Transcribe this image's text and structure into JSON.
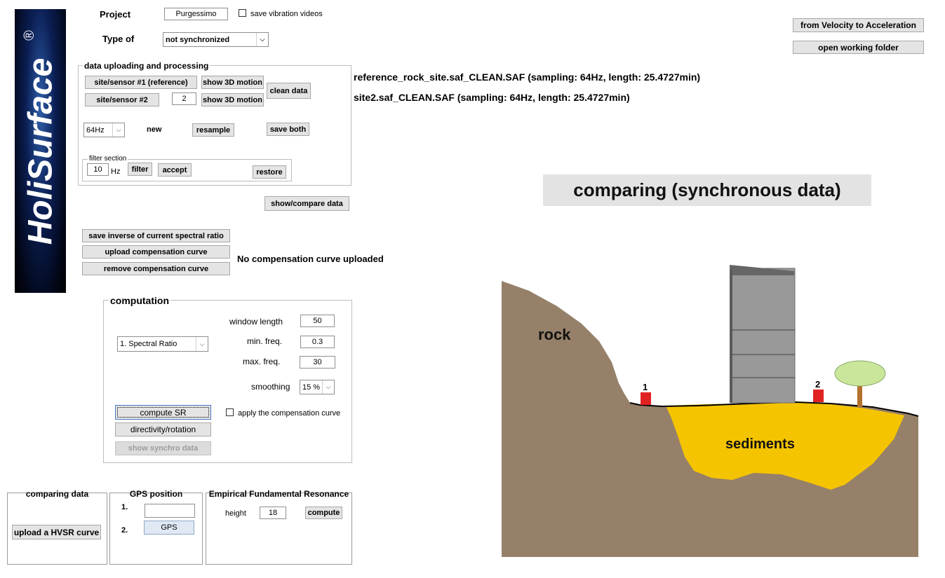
{
  "logo": {
    "text": "HoliSurface",
    "mark": "®"
  },
  "project": {
    "label": "Project",
    "value": "Purgessimo",
    "save_videos_label": "save vibration videos"
  },
  "type_of": {
    "label": "Type of",
    "selected": "not synchronized"
  },
  "top_right": {
    "velocity_button": "from Velocity to Acceleration",
    "folder_button": "open working folder"
  },
  "files": {
    "file1": "reference_rock_site.saf_CLEAN.SAF (sampling: 64Hz, length: 25.4727min)",
    "file2": "site2.saf_CLEAN.SAF (sampling: 64Hz, length: 25.4727min)"
  },
  "upload_group": {
    "title": "data uploading and processing",
    "sensor1_button": "site/sensor #1 (reference)",
    "sensor2_button": "site/sensor #2",
    "show3d_1": "show 3D motion",
    "show3d_2": "show 3D motion",
    "sensor_number": "2",
    "clean_button": "clean data",
    "sampling_selected": "64Hz",
    "new_label": "new",
    "resample_button": "resample",
    "save_both_button": "save both",
    "filter": {
      "title": "filter section",
      "value": "10",
      "unit": "Hz",
      "filter_button": "filter",
      "accept_button": "accept",
      "restore_button": "restore"
    }
  },
  "show_compare_button": "show/compare data",
  "compensation": {
    "save_inverse_button": "save inverse of current spectral ratio",
    "upload_button": "upload compensation curve",
    "remove_button": "remove compensation curve",
    "status": "No compensation curve uploaded"
  },
  "computation": {
    "title": "computation",
    "method_selected": "1. Spectral Ratio",
    "window_length_label": "window length",
    "window_length": "50",
    "min_freq_label": "min. freq.",
    "min_freq": "0.3",
    "max_freq_label": "max. freq.",
    "max_freq": "30",
    "smoothing_label": "smoothing",
    "smoothing_selected": "15 %",
    "compute_button": "compute SR",
    "apply_label": "apply the compensation curve",
    "directivity_button": "directivity/rotation",
    "synchro_button": "show synchro data"
  },
  "comparing_data": {
    "title": "comparing data",
    "upload_button": "upload a HVSR curve"
  },
  "gps": {
    "title": "GPS position",
    "row1": "1.",
    "row2": "2.",
    "gps_button": "GPS",
    "field1": ""
  },
  "efr": {
    "title": "Empirical Fundamental Resonance",
    "height_label": "height",
    "height": "18",
    "compute_button": "compute"
  },
  "mode_banner": "comparing (synchronous data)",
  "illustration": {
    "rock_label": "rock",
    "sediments_label": "sediments",
    "sensor1": "1",
    "sensor2": "2",
    "colors": {
      "rock": "#968069",
      "sediments": "#f5c400",
      "building": "#999999",
      "sensor": "#e02222",
      "tree": "#c9e69a",
      "trunk": "#b3712d"
    }
  }
}
